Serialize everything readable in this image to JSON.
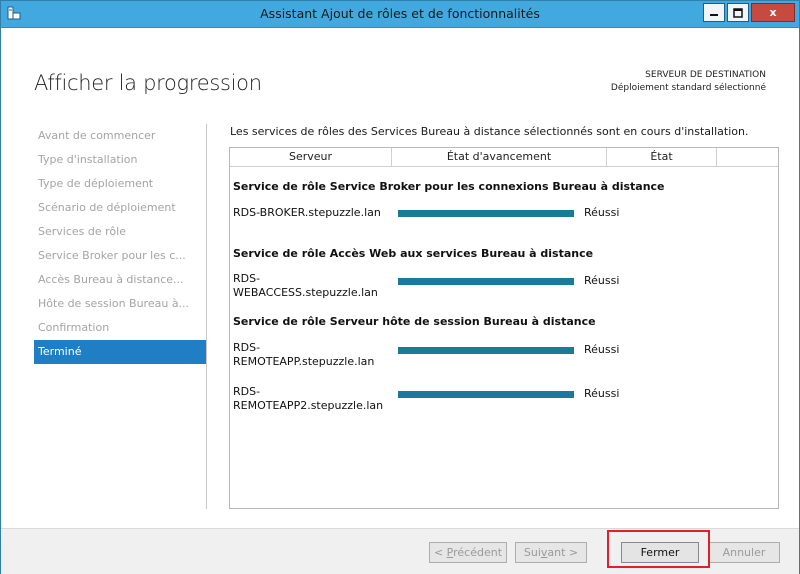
{
  "window": {
    "title": "Assistant Ajout de rôles et de fonctionnalités",
    "close_glyph": "x"
  },
  "header": {
    "page_title": "Afficher la progression",
    "destination_label": "SERVEUR DE DESTINATION",
    "destination_value": "Déploiement standard sélectionné"
  },
  "nav": {
    "items": [
      {
        "label": "Avant de commencer",
        "active": false
      },
      {
        "label": "Type d'installation",
        "active": false
      },
      {
        "label": "Type de déploiement",
        "active": false
      },
      {
        "label": "Scénario de déploiement",
        "active": false
      },
      {
        "label": "Services de rôle",
        "active": false
      },
      {
        "label": "Service Broker pour les c...",
        "active": false
      },
      {
        "label": "Accès Bureau à distance...",
        "active": false
      },
      {
        "label": "Hôte de session Bureau à...",
        "active": false
      },
      {
        "label": "Confirmation",
        "active": false
      },
      {
        "label": "Terminé",
        "active": true
      }
    ]
  },
  "content": {
    "intro": "Les services de rôles des Services Bureau à distance sélectionnés sont en cours d'installation.",
    "columns": [
      "Serveur",
      "État d'avancement",
      "État",
      ""
    ],
    "groups": [
      {
        "title": "Service de rôle Service Broker pour les connexions Bureau à distance",
        "rows": [
          {
            "server": "RDS-BROKER.stepuzzle.lan",
            "progress": 1.0,
            "status": "Réussi"
          }
        ]
      },
      {
        "title": "Service de rôle Accès Web aux services Bureau à distance",
        "rows": [
          {
            "server": "RDS-\nWEBACCESS.stepuzzle.lan",
            "progress": 1.0,
            "status": "Réussi"
          }
        ]
      },
      {
        "title": "Service de rôle Serveur hôte de session Bureau à distance",
        "rows": [
          {
            "server": "RDS-\nREMOTEAPP.stepuzzle.lan",
            "progress": 1.0,
            "status": "Réussi"
          },
          {
            "server": "RDS-\nREMOTEAPP2.stepuzzle.lan",
            "progress": 1.0,
            "status": "Réussi"
          }
        ]
      }
    ]
  },
  "footer": {
    "prev_prefix": "< ",
    "prev_ul": "P",
    "prev_rest": "récédent",
    "next_prefix": "Sui",
    "next_ul": "v",
    "next_rest": "ant >",
    "close_label": "Fermer",
    "cancel_label": "Annuler"
  },
  "colors": {
    "titlebar": "#42a8e0",
    "active_nav": "#1f7ec4",
    "progress_fill": "#1a7a9a",
    "highlight": "#e0202a"
  }
}
